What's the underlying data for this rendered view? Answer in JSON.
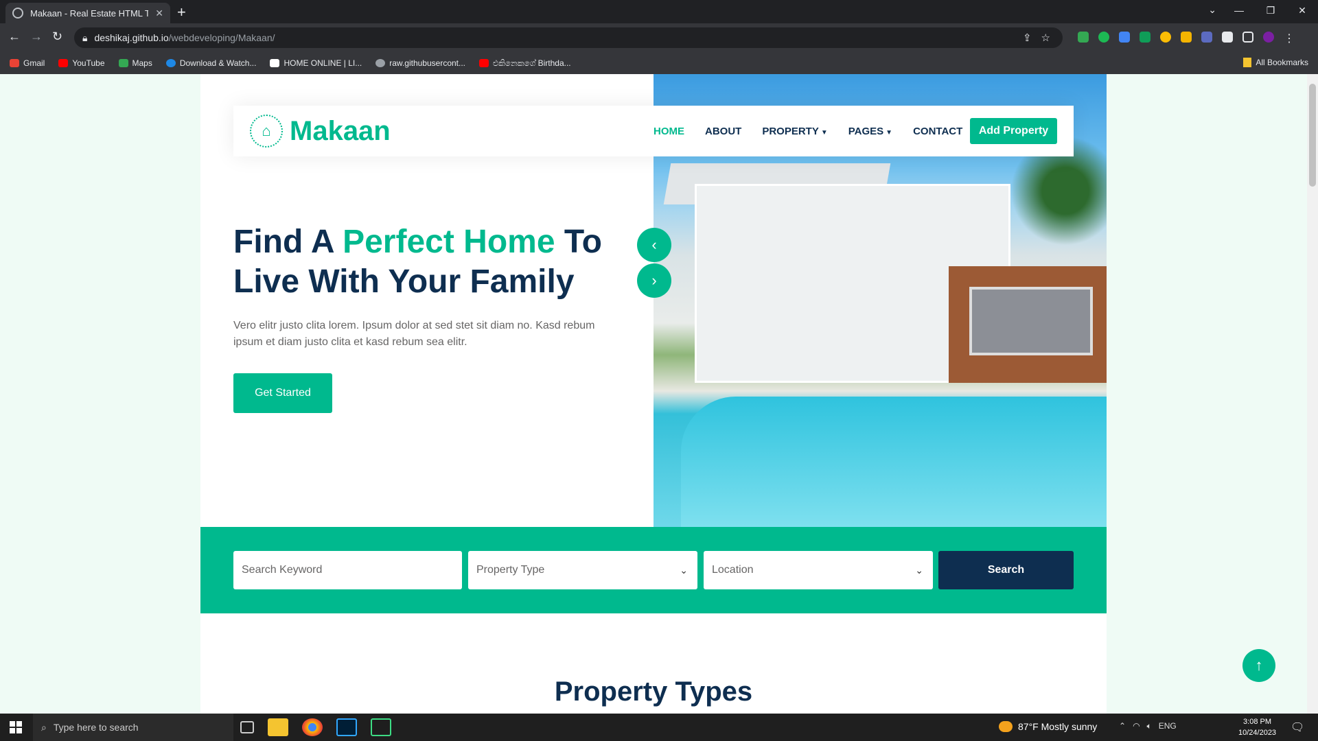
{
  "browser": {
    "tab_title": "Makaan - Real Estate HTML Tem",
    "tab_close": "✕",
    "new_tab": "+",
    "url_host": "deshikaj.github.io",
    "url_path": "/webdeveloping/Makaan/",
    "bookmarks": [
      {
        "label": "Gmail",
        "color": "#ea4335"
      },
      {
        "label": "YouTube",
        "color": "#ff0000"
      },
      {
        "label": "Maps",
        "color": "#34a853"
      },
      {
        "label": "Download & Watch...",
        "color": "#1e88e5"
      },
      {
        "label": "HOME ONLINE | LI...",
        "color": "#ffffff"
      },
      {
        "label": "raw.githubusercont...",
        "color": "#9aa0a6"
      },
      {
        "label": "එකිනෙකගේ Birthda...",
        "color": "#ff0000"
      }
    ],
    "all_bookmarks": "All Bookmarks"
  },
  "site": {
    "logo_text": "Makaan",
    "menu": [
      "HOME",
      "ABOUT",
      "PROPERTY",
      "PAGES",
      "CONTACT"
    ],
    "add_property": "Add Property",
    "headline_part1": "Find A ",
    "headline_accent": "Perfect Home",
    "headline_part2": " To Live With Your Family",
    "lead": "Vero elitr justo clita lorem. Ipsum dolor at sed stet sit diam no. Kasd rebum ipsum et diam justo clita et kasd rebum sea elitr.",
    "cta": "Get Started",
    "search": {
      "keyword_placeholder": "Search Keyword",
      "type_label": "Property Type",
      "location_label": "Location",
      "button": "Search"
    },
    "section_title": "Property Types",
    "accent_color": "#00b98e",
    "dark_color": "#0e2e50"
  },
  "taskbar": {
    "search_placeholder": "Type here to search",
    "weather": "87°F  Mostly sunny",
    "lang": "ENG",
    "time": "3:08 PM",
    "date": "10/24/2023"
  }
}
